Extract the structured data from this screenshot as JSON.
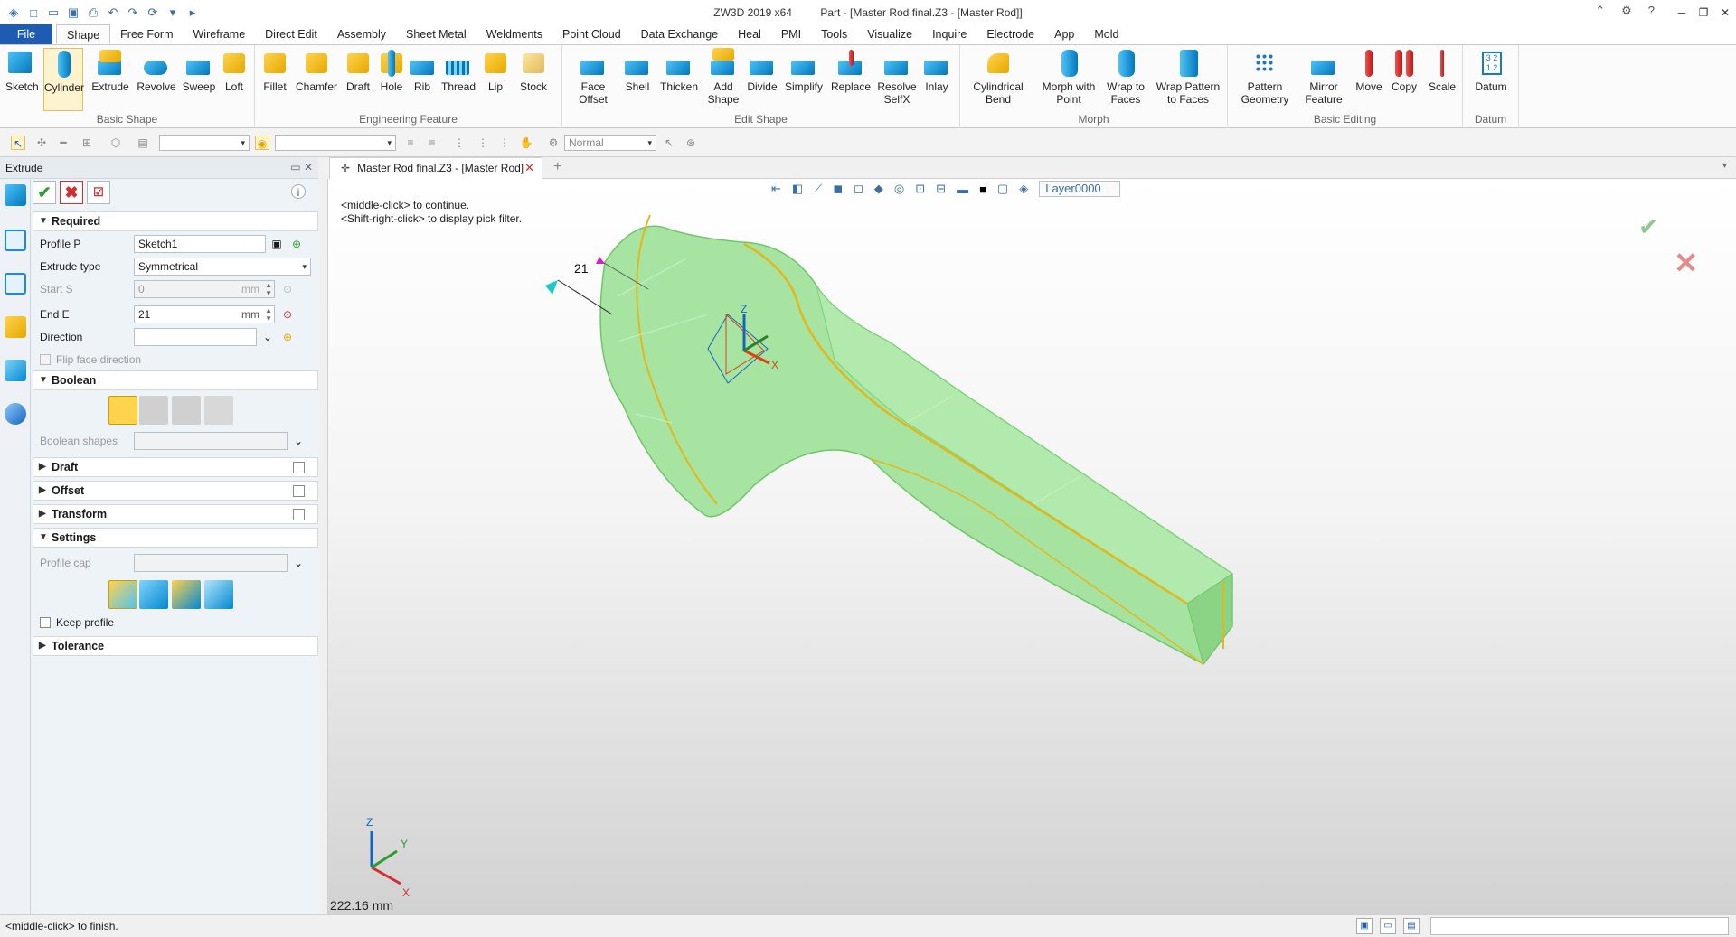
{
  "window": {
    "app": "ZW3D 2019  x64",
    "document": "Part - [Master Rod final.Z3 - [Master Rod]]"
  },
  "tabs": [
    "File",
    "Shape",
    "Free Form",
    "Wireframe",
    "Direct Edit",
    "Assembly",
    "Sheet Metal",
    "Weldments",
    "Point Cloud",
    "Data Exchange",
    "Heal",
    "PMI",
    "Tools",
    "Visualize",
    "Inquire",
    "Electrode",
    "App",
    "Mold"
  ],
  "ribbon": {
    "groups": {
      "basic_shape": "Basic Shape",
      "engineering_feature": "Engineering Feature",
      "edit_shape": "Edit Shape",
      "morph": "Morph",
      "basic_editing": "Basic Editing",
      "datum": "Datum"
    },
    "buttons": {
      "sketch": "Sketch",
      "cylinder": "Cylinder",
      "extrude": "Extrude",
      "revolve": "Revolve",
      "sweep": "Sweep",
      "loft": "Loft",
      "fillet": "Fillet",
      "chamfer": "Chamfer",
      "draft": "Draft",
      "hole": "Hole",
      "rib": "Rib",
      "thread": "Thread",
      "lip": "Lip",
      "stock": "Stock",
      "face_offset_1": "Face",
      "face_offset_2": "Offset",
      "shell": "Shell",
      "thicken": "Thicken",
      "add_shape_1": "Add",
      "add_shape_2": "Shape",
      "divide": "Divide",
      "simplify": "Simplify",
      "replace": "Replace",
      "resolve_1": "Resolve",
      "resolve_2": "SelfX",
      "inlay": "Inlay",
      "cyl_bend_1": "Cylindrical",
      "cyl_bend_2": "Bend",
      "morph_pt_1": "Morph with",
      "morph_pt_2": "Point",
      "wrap_faces_1": "Wrap to",
      "wrap_faces_2": "Faces",
      "wrap_pattern_1": "Wrap Pattern",
      "wrap_pattern_2": "to Faces",
      "pattern_1": "Pattern",
      "pattern_2": "Geometry",
      "mirror_1": "Mirror",
      "mirror_2": "Feature",
      "move": "Move",
      "copy": "Copy",
      "scale": "Scale",
      "datum": "Datum"
    }
  },
  "toolbar2": {
    "render_mode": "Normal"
  },
  "panel": {
    "title": "Extrude",
    "sections": {
      "required": "Required",
      "boolean": "Boolean",
      "draft": "Draft",
      "offset": "Offset",
      "transform": "Transform",
      "settings": "Settings",
      "tolerance": "Tolerance"
    },
    "profile_label": "Profile P",
    "profile_value": "Sketch1",
    "extrude_type_label": "Extrude type",
    "extrude_type_value": "Symmetrical",
    "start_label": "Start S",
    "start_value": "0",
    "start_unit": "mm",
    "end_label": "End E",
    "end_value": "21",
    "end_unit": "mm",
    "direction_label": "Direction",
    "flip_label": "Flip face direction",
    "boolean_shapes_label": "Boolean shapes",
    "profile_cap_label": "Profile cap",
    "keep_profile_label": "Keep profile"
  },
  "doc_tab": "Master Rod final.Z3 - [Master Rod]",
  "viewport": {
    "hint1": "<middle-click> to continue.",
    "hint2": "<Shift-right-click> to display pick filter.",
    "layer": "Layer0000",
    "dimension_label": "21",
    "measure": "222.16 mm",
    "axis_x": "X",
    "axis_y": "Y",
    "axis_z": "Z"
  },
  "status": {
    "message": "<middle-click> to finish."
  },
  "colors": {
    "accent": "#1e5cb3",
    "part_fill": "#9fe29a",
    "part_edge": "#e3b71a"
  }
}
